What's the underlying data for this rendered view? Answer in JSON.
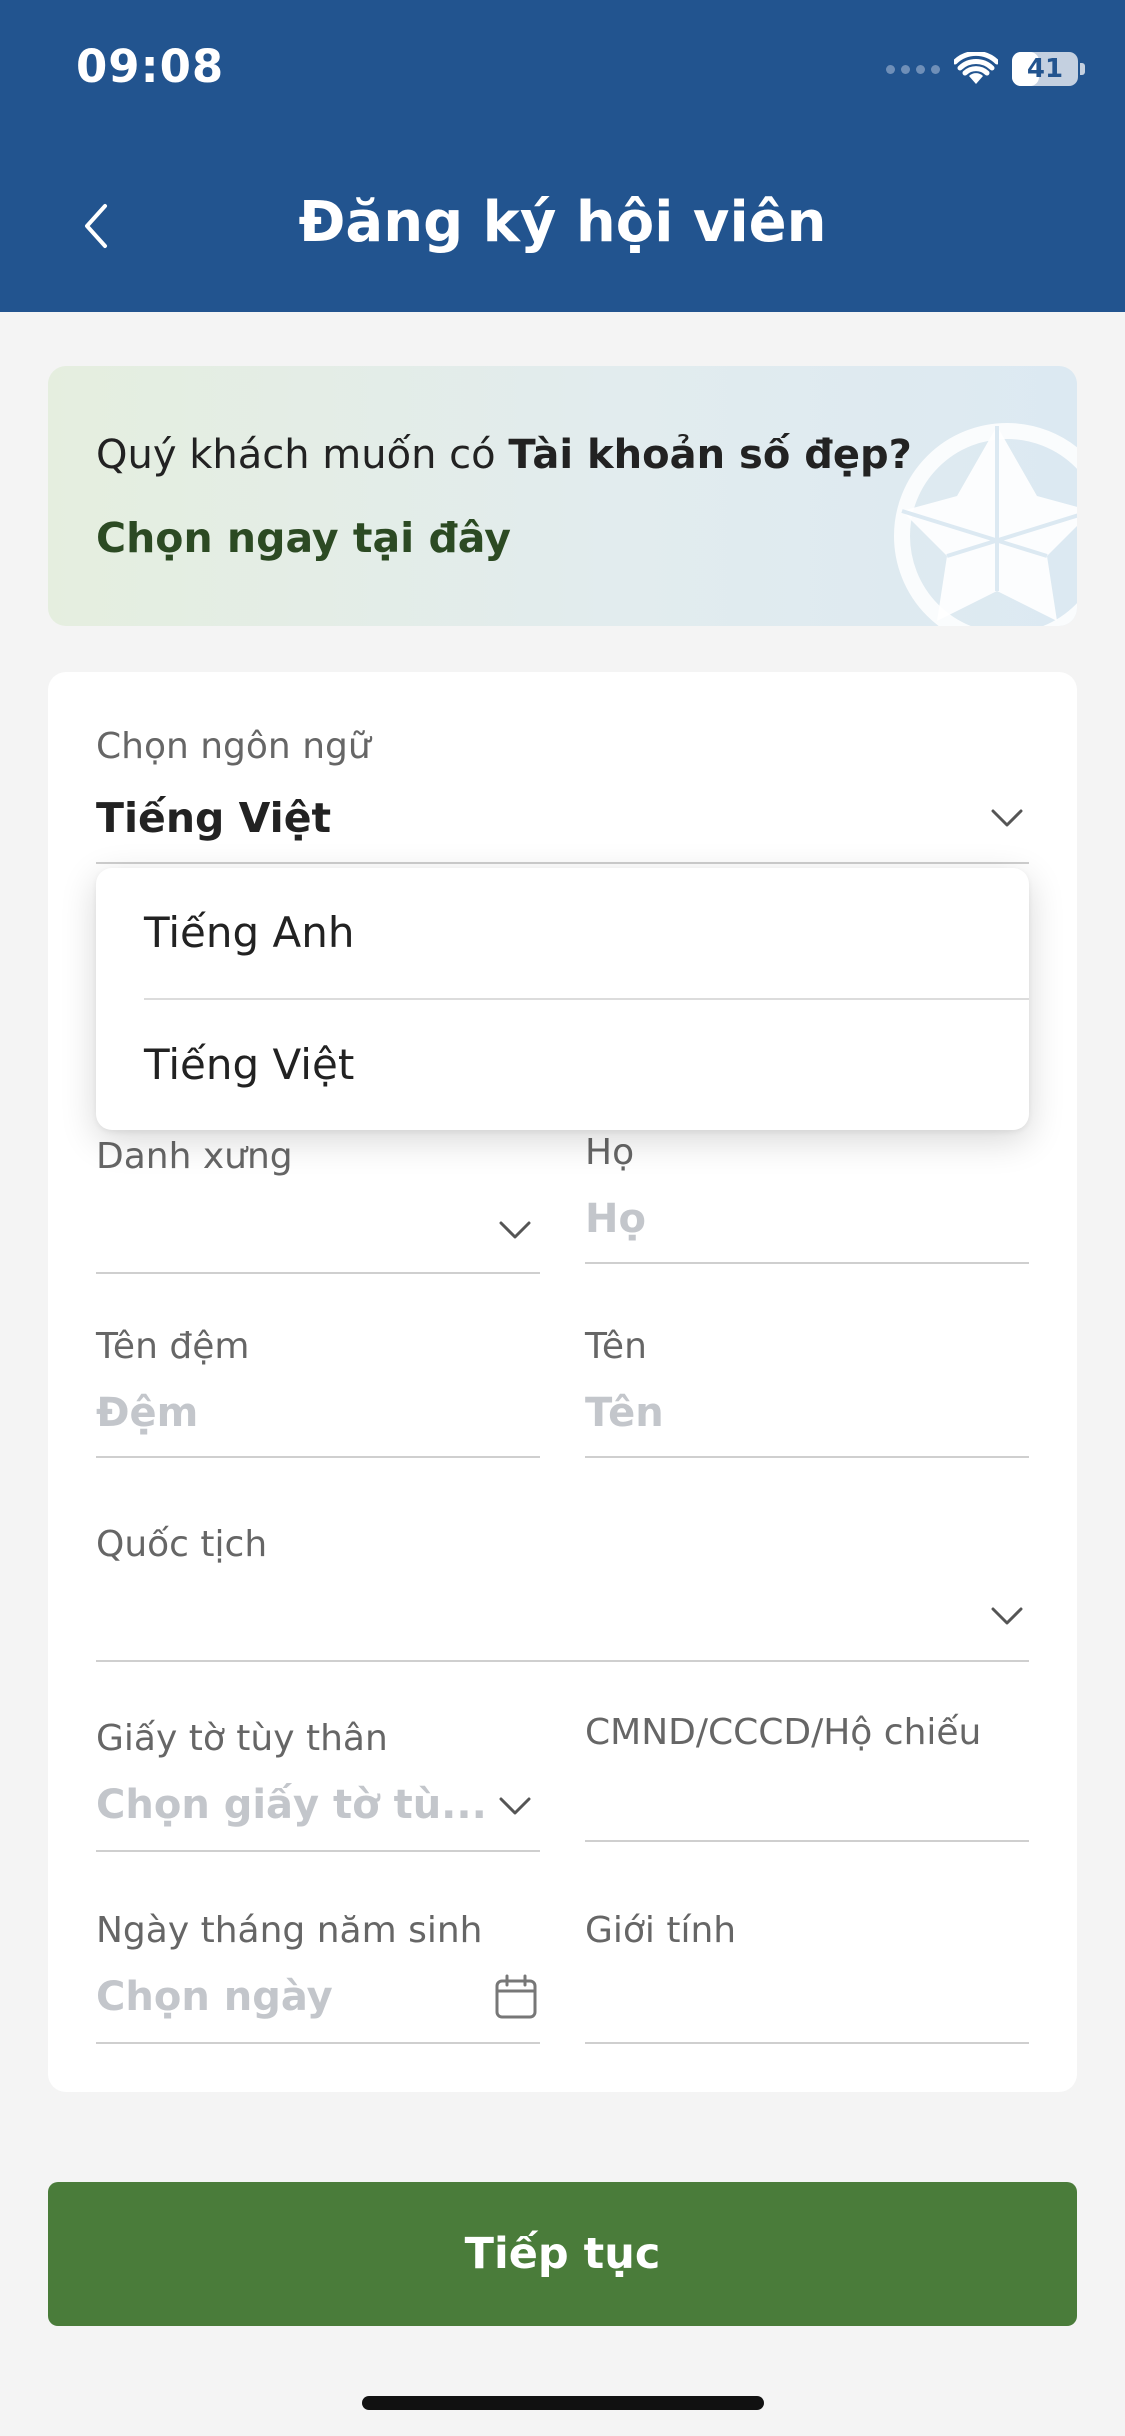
{
  "status_bar": {
    "time": "09:08",
    "battery": "41",
    "battery_level": 0.41
  },
  "header": {
    "title": "Đăng ký hội viên"
  },
  "promo": {
    "text_prefix": "Quý khách muốn có ",
    "text_bold": "Tài khoản số đẹp?",
    "link": "Chọn ngay tại đây"
  },
  "form": {
    "language": {
      "label": "Chọn ngôn ngữ",
      "value": "Tiếng Việt"
    },
    "language_options": [
      "Tiếng Anh",
      "Tiếng Việt"
    ],
    "title": {
      "label": "Danh xưng"
    },
    "last_name": {
      "label": "Họ",
      "placeholder": "Họ"
    },
    "middle_name": {
      "label": "Tên đệm",
      "placeholder": "Đệm"
    },
    "first_name": {
      "label": "Tên",
      "placeholder": "Tên"
    },
    "nationality": {
      "label": "Quốc tịch"
    },
    "id_type": {
      "label": "Giấy tờ tùy thân",
      "placeholder": "Chọn giấy tờ tù..."
    },
    "id_number": {
      "label": "CMND/CCCD/Hộ chiếu"
    },
    "dob": {
      "label": "Ngày tháng năm sinh",
      "placeholder": "Chọn ngày"
    },
    "gender": {
      "label": "Giới tính"
    }
  },
  "actions": {
    "continue": "Tiếp tục"
  },
  "colors": {
    "header": "#22548f",
    "primary_button": "#4a7c3a",
    "promo_link": "#2c4a23"
  }
}
